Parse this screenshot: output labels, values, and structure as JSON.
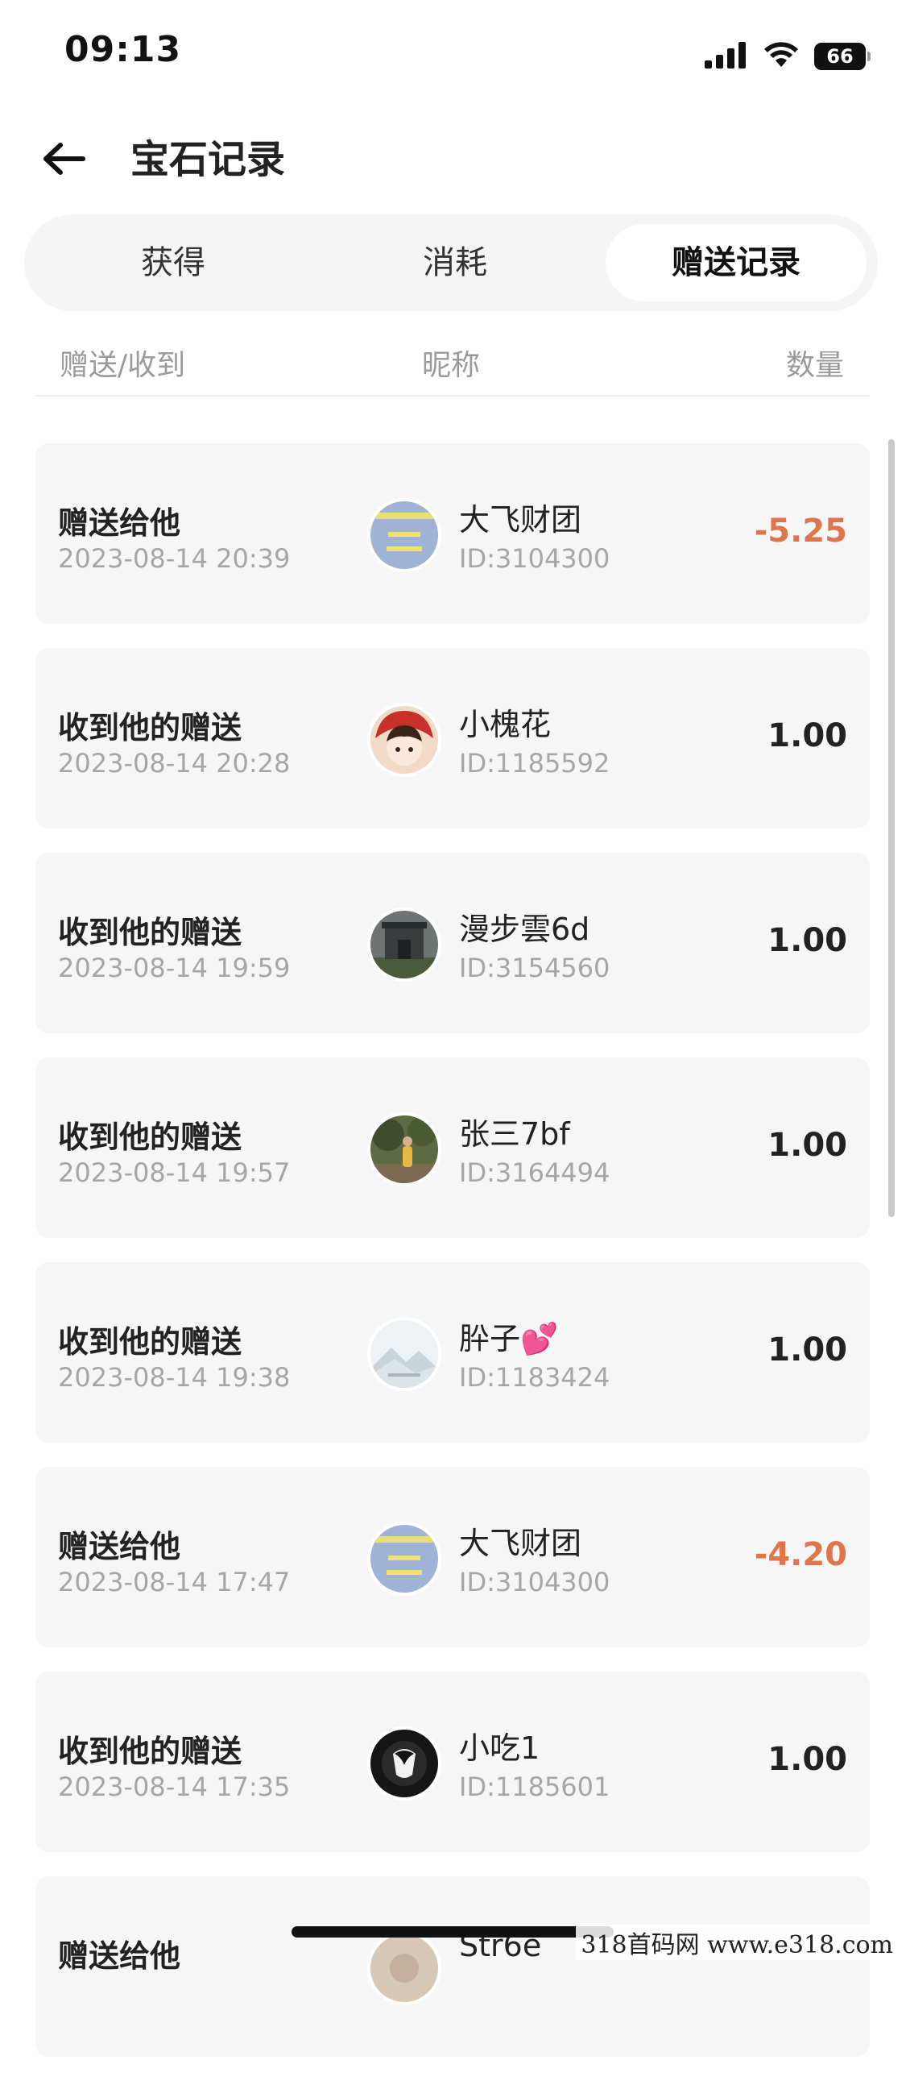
{
  "status_bar": {
    "time": "09:13",
    "battery": "66"
  },
  "header": {
    "back_icon": "arrow-left-icon",
    "title": "宝石记录"
  },
  "tabs": [
    {
      "label": "获得",
      "active": false
    },
    {
      "label": "消耗",
      "active": false
    },
    {
      "label": "赠送记录",
      "active": true
    }
  ],
  "table_header": {
    "direction": "赠送/收到",
    "nickname": "昵称",
    "amount": "数量"
  },
  "colors": {
    "negative_amount": "#e0744a",
    "card_background": "#f6f6f6",
    "muted_text": "#a6a6a6"
  },
  "records": [
    {
      "type": "赠送给他",
      "time": "2023-08-14 20:39",
      "name": "大飞财团",
      "id": "ID:3104300",
      "amount": "-5.25",
      "avatar": "text-card-avatar"
    },
    {
      "type": "收到他的赠送",
      "time": "2023-08-14 20:28",
      "name": "小槐花",
      "id": "ID:1185592",
      "amount": "1.00",
      "avatar": "cartoon-girl-avatar"
    },
    {
      "type": "收到他的赠送",
      "time": "2023-08-14 19:59",
      "name": "漫步雲6d",
      "id": "ID:3154560",
      "amount": "1.00",
      "avatar": "building-photo-avatar"
    },
    {
      "type": "收到他的赠送",
      "time": "2023-08-14 19:57",
      "name": "张三7bf",
      "id": "ID:3164494",
      "amount": "1.00",
      "avatar": "outdoor-photo-avatar"
    },
    {
      "type": "收到他的赠送",
      "time": "2023-08-14 19:38",
      "name": "肸子💕",
      "id": "ID:1183424",
      "amount": "1.00",
      "avatar": "landscape-avatar"
    },
    {
      "type": "赠送给他",
      "time": "2023-08-14 17:47",
      "name": "大飞财团",
      "id": "ID:3104300",
      "amount": "-4.20",
      "avatar": "text-card-avatar"
    },
    {
      "type": "收到他的赠送",
      "time": "2023-08-14 17:35",
      "name": "小吃1",
      "id": "ID:1185601",
      "amount": "1.00",
      "avatar": "dark-portrait-avatar"
    },
    {
      "type": "赠送给他",
      "time": "",
      "name": "Str6e",
      "id": "",
      "amount": "",
      "avatar": "beige-avatar"
    }
  ],
  "watermark": "318首码网  www.e318.com"
}
